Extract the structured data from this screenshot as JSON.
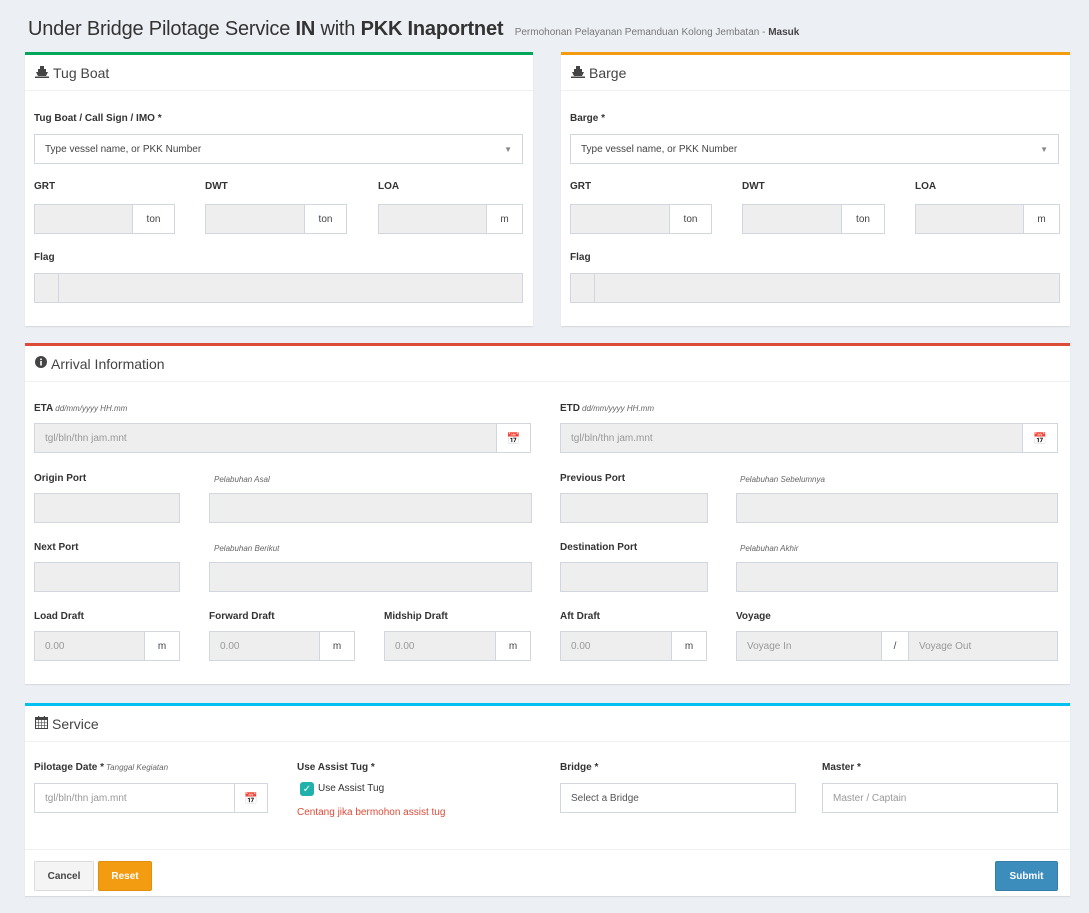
{
  "title": {
    "part1": "Under Bridge Pilotage Service ",
    "part2": "IN",
    "part3": " with ",
    "part4": "PKK Inaportnet",
    "subtitle": "Permohonan Pelayanan Pemanduan Kolong Jembatan - ",
    "subtitle_bold": "Masuk"
  },
  "tug": {
    "header": "Tug Boat",
    "icon": "ship-icon",
    "select_label": "Tug Boat / Call Sign / IMO *",
    "select_placeholder": "Type vessel name, or PKK Number",
    "grt_label": "GRT",
    "grt_unit": "ton",
    "dwt_label": "DWT",
    "dwt_unit": "ton",
    "loa_label": "LOA",
    "loa_unit": "m",
    "flag_label": "Flag"
  },
  "barge": {
    "header": "Barge",
    "icon": "ship-icon",
    "select_label": "Barge *",
    "select_placeholder": "Type vessel name, or PKK Number",
    "grt_label": "GRT",
    "grt_unit": "ton",
    "dwt_label": "DWT",
    "dwt_unit": "ton",
    "loa_label": "LOA",
    "loa_unit": "m",
    "flag_label": "Flag"
  },
  "arrival": {
    "header": "Arrival Information",
    "icon": "info-circle-icon",
    "eta_label": "ETA",
    "eta_hint": "dd/mm/yyyy HH.mm",
    "eta_placeholder": "tgl/bln/thn jam.mnt",
    "etd_label": "ETD",
    "etd_hint": "dd/mm/yyyy HH.mm",
    "etd_placeholder": "tgl/bln/thn jam.mnt",
    "origin_label": "Origin Port",
    "origin_hint": "Pelabuhan Asal",
    "previous_label": "Previous Port",
    "previous_hint": "Pelabuhan Sebelumnya",
    "next_label": "Next Port",
    "next_hint": "Pelabuhan Berikut",
    "destination_label": "Destination Port",
    "destination_hint": "Pelabuhan Akhir",
    "load_draft_label": "Load Draft",
    "load_draft_value": "0.00",
    "forward_draft_label": "Forward Draft",
    "forward_draft_value": "0.00",
    "midship_draft_label": "Midship Draft",
    "midship_draft_value": "0.00",
    "aft_draft_label": "Aft Draft",
    "aft_draft_value": "0.00",
    "draft_unit": "m",
    "voyage_label": "Voyage",
    "voyage_in": "Voyage In",
    "voyage_sep": "/",
    "voyage_out": "Voyage Out"
  },
  "service": {
    "header": "Service",
    "icon": "calendar-icon",
    "pilotage_date_label": "Pilotage Date *",
    "pilotage_date_hint": "Tanggal Kegiatan",
    "pilotage_date_placeholder": "tgl/bln/thn jam.mnt",
    "assist_label": "Use Assist Tug *",
    "assist_checkbox_label": "Use Assist Tug",
    "assist_checked": true,
    "assist_hint": "Centang jika bermohon assist tug",
    "bridge_label": "Bridge *",
    "bridge_placeholder": "Select a Bridge",
    "master_label": "Master *",
    "master_placeholder": "Master / Captain"
  },
  "buttons": {
    "cancel": "Cancel",
    "reset": "Reset",
    "submit": "Submit"
  },
  "colors": {
    "green": "#00a65a",
    "orange": "#f39c12",
    "red": "#dd4b39",
    "aqua": "#00c0ef",
    "primary": "#3c8dbc"
  }
}
